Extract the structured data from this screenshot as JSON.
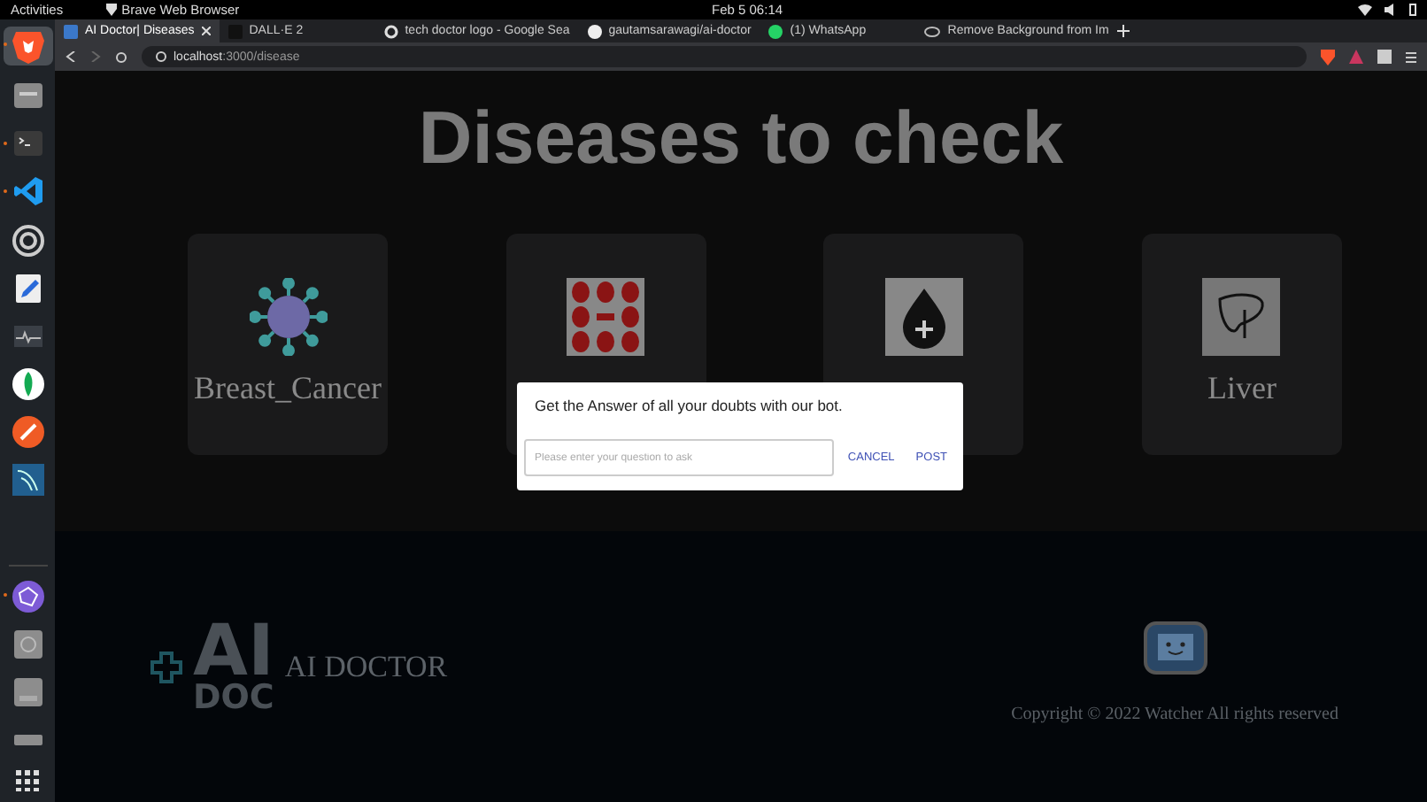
{
  "top_bar": {
    "activities": "Activities",
    "app_name": "Brave Web Browser",
    "clock": "Feb 5  06:14"
  },
  "dock": {
    "apps": [
      {
        "kind": "brave",
        "running": true,
        "selected": true
      },
      {
        "kind": "files",
        "running": false,
        "selected": false
      },
      {
        "kind": "terminal",
        "running": true,
        "selected": false
      },
      {
        "kind": "vscode",
        "running": true,
        "selected": false
      },
      {
        "kind": "settings",
        "running": false,
        "selected": false
      },
      {
        "kind": "editor",
        "running": false,
        "selected": false
      },
      {
        "kind": "monitor",
        "running": false,
        "selected": false
      },
      {
        "kind": "leaf",
        "running": false,
        "selected": false
      },
      {
        "kind": "postman",
        "running": false,
        "selected": false
      },
      {
        "kind": "workbench",
        "running": false,
        "selected": false
      }
    ],
    "devices": [
      {
        "kind": "graph",
        "running": true,
        "selected": false
      },
      {
        "kind": "disc",
        "running": false,
        "selected": false
      },
      {
        "kind": "ssd",
        "running": false,
        "selected": false
      },
      {
        "kind": "drive",
        "running": false,
        "selected": false
      }
    ]
  },
  "browser": {
    "tabs": [
      {
        "label": "AI Doctor| Diseases",
        "kind": "doc",
        "selected": true
      },
      {
        "label": "DALL·E 2",
        "kind": "dark",
        "selected": false
      },
      {
        "label": "tech doctor logo - Google Sea",
        "kind": "google",
        "selected": false
      },
      {
        "label": "gautamsarawagi/ai-doctor",
        "kind": "github",
        "selected": false
      },
      {
        "label": "(1) WhatsApp",
        "kind": "whatsapp",
        "selected": false
      },
      {
        "label": "Remove Background from Im",
        "kind": "eye",
        "selected": false
      }
    ],
    "address_host": "localhost",
    "address_path": ":3000/disease"
  },
  "page": {
    "heading": "Diseases to check",
    "cards": [
      {
        "kind": "virus",
        "label": "Breast_Cancer"
      },
      {
        "kind": "cells"
      },
      {
        "kind": "drop"
      },
      {
        "kind": "liver",
        "label": "Liver"
      }
    ],
    "dialog": {
      "message": "Get the Answer of all your doubts with our bot.",
      "placeholder": "Please enter your question to ask",
      "buttons": [
        "CANCEL",
        "POST"
      ]
    },
    "footer": {
      "logo_top": "AI",
      "logo_bottom": "DOC",
      "brand": "AI DOCTOR",
      "copyright": "Copyright © 2022 Watcher All rights reserved"
    }
  }
}
